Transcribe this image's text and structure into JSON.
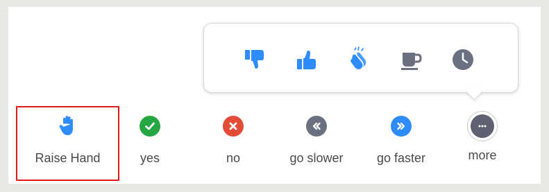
{
  "toolbar": {
    "items": [
      {
        "label": "Raise Hand",
        "icon": "raise-hand-icon",
        "color": "#2d8cff"
      },
      {
        "label": "yes",
        "icon": "check-icon",
        "color": "#25a744"
      },
      {
        "label": "no",
        "icon": "x-icon",
        "color": "#e34a37"
      },
      {
        "label": "go slower",
        "icon": "rewind-icon",
        "color": "#6b7080"
      },
      {
        "label": "go faster",
        "icon": "fast-forward-icon",
        "color": "#2d8cff"
      },
      {
        "label": "more",
        "icon": "more-dots-icon",
        "color": "#5d6170"
      }
    ],
    "selected": "Raise Hand",
    "highlight_color": "#e0191b"
  },
  "reactions_popup": {
    "icons": [
      {
        "icon": "thumbs-down-icon",
        "color": "#2d8cff"
      },
      {
        "icon": "thumbs-up-icon",
        "color": "#2d8cff"
      },
      {
        "icon": "clapping-hands-icon",
        "color": "#2d8cff"
      },
      {
        "icon": "coffee-cup-icon",
        "color": "#6b7080"
      },
      {
        "icon": "clock-icon",
        "color": "#6b7080"
      }
    ]
  }
}
